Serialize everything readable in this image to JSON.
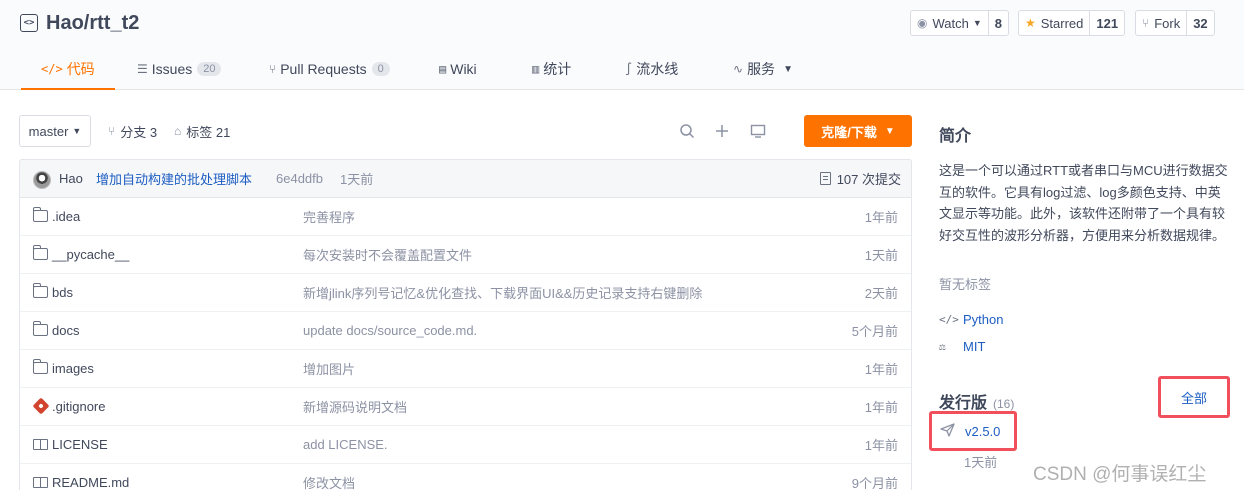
{
  "repo": {
    "owner_name": "Hao/rtt_t2",
    "icon": "code-repo-icon"
  },
  "actions": {
    "watch": {
      "label": "Watch",
      "count": "8"
    },
    "star": {
      "label": "Starred",
      "count": "121"
    },
    "fork": {
      "label": "Fork",
      "count": "32"
    }
  },
  "tabs": [
    {
      "label": "代码",
      "icon": "</>"
    },
    {
      "label": "Issues",
      "badge": "20"
    },
    {
      "label": "Pull Requests",
      "badge": "0"
    },
    {
      "label": "Wiki"
    },
    {
      "label": "统计"
    },
    {
      "label": "流水线"
    },
    {
      "label": "服务"
    }
  ],
  "toolbar": {
    "branch": "master",
    "branches": "分支 3",
    "tags": "标签 21",
    "clone": "克隆/下载"
  },
  "commit": {
    "author": "Hao",
    "message": "增加自动构建的批处理脚本",
    "sha": "6e4ddfb",
    "time": "1天前",
    "count": "107 次提交"
  },
  "files": [
    {
      "type": "folder",
      "name": ".idea",
      "message": "完善程序",
      "time": "1年前"
    },
    {
      "type": "folder",
      "name": "__pycache__",
      "message": "每次安装时不会覆盖配置文件",
      "time": "1天前"
    },
    {
      "type": "folder",
      "name": "bds",
      "message": "新增jlink序列号记忆&优化查找、下载界面UI&&历史记录支持右键删除",
      "time": "2天前"
    },
    {
      "type": "folder",
      "name": "docs",
      "message": "update docs/source_code.md.",
      "time": "5个月前"
    },
    {
      "type": "folder",
      "name": "images",
      "message": "增加图片",
      "time": "1年前"
    },
    {
      "type": "git",
      "name": ".gitignore",
      "message": "新增源码说明文档",
      "time": "1年前"
    },
    {
      "type": "book",
      "name": "LICENSE",
      "message": "add LICENSE.",
      "time": "1年前"
    },
    {
      "type": "book",
      "name": "README.md",
      "message": "修改文档",
      "time": "9个月前"
    }
  ],
  "sidebar": {
    "intro_title": "简介",
    "description": "这是一个可以通过RTT或者串口与MCU进行数据交互的软件。它具有log过滤、log多颜色支持、中英文显示等功能。此外，该软件还附带了一个具有较好交互性的波形分析器，方便用来分析数据规律。",
    "no_tags": "暂无标签",
    "language": "Python",
    "license": "MIT",
    "releases_title": "发行版",
    "releases_count": "(16)",
    "all_link": "全部",
    "latest_version": "v2.5.0",
    "latest_time": "1天前"
  },
  "watermark": "CSDN @何事误红尘"
}
